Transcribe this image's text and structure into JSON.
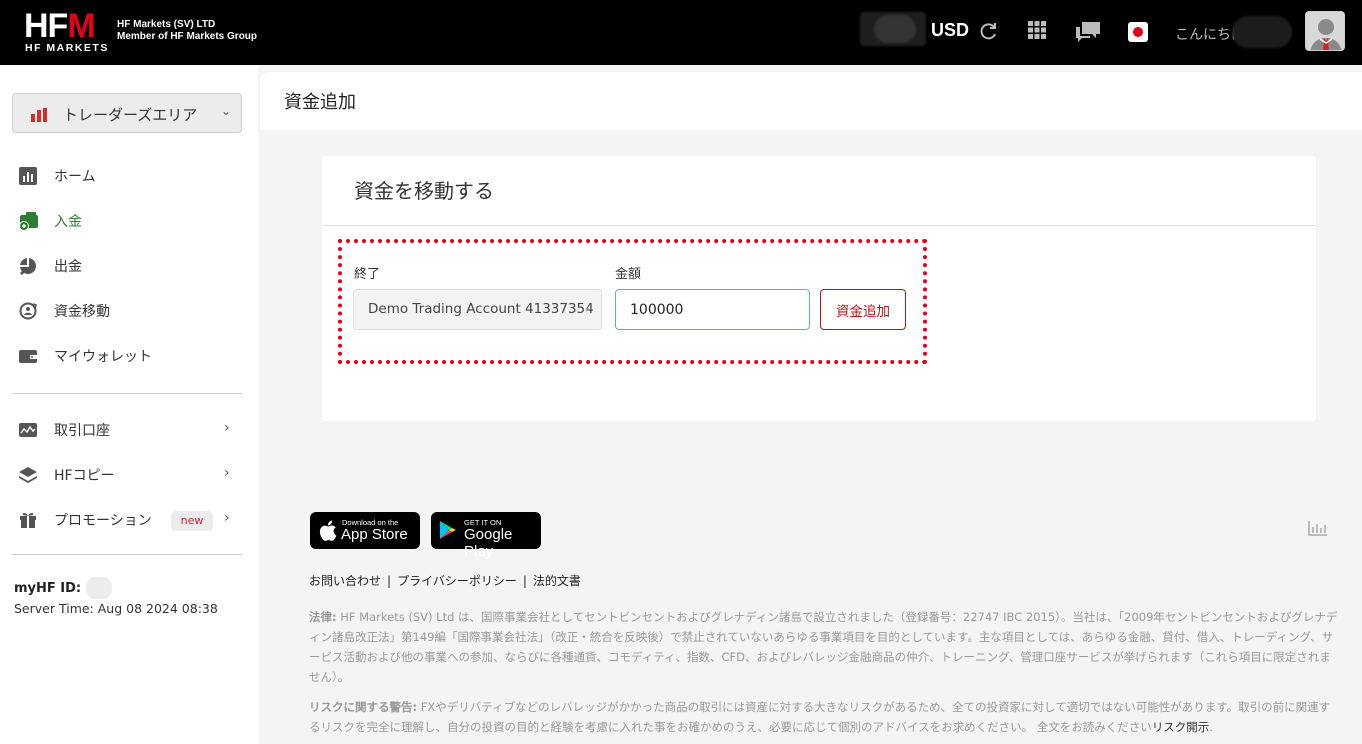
{
  "header": {
    "logo_text": "HFM",
    "logo_sub": "HF MARKETS",
    "company_line1": "HF Markets (SV) LTD",
    "company_line2": "Member of HF Markets Group",
    "currency": "USD",
    "greeting": "こんにちは"
  },
  "sidebar": {
    "area_select": "トレーダーズエリア",
    "items": [
      {
        "label": "ホーム",
        "icon": "bar-chart-icon"
      },
      {
        "label": "入金",
        "icon": "deposit-icon"
      },
      {
        "label": "出金",
        "icon": "withdraw-icon"
      },
      {
        "label": "資金移動",
        "icon": "transfer-icon"
      },
      {
        "label": "マイウォレット",
        "icon": "wallet-icon"
      },
      {
        "label": "取引口座",
        "icon": "trading-account-icon"
      },
      {
        "label": "HFコピー",
        "icon": "layers-icon"
      },
      {
        "label": "プロモーション",
        "icon": "gift-icon"
      }
    ],
    "new_badge": "new",
    "myhf_label": "myHF ID:",
    "server_time": "Server Time: Aug 08 2024 08:38"
  },
  "main": {
    "page_title": "資金追加",
    "card_title": "資金を移動する",
    "to_label": "終了",
    "amount_label": "金額",
    "account_value": "Demo Trading Account 41337354",
    "amount_value": "100000",
    "add_button": "資金追加"
  },
  "footer": {
    "app_store_small": "Download on the",
    "app_store_big": "App Store",
    "google_small": "GET IT ON",
    "google_big": "Google Play",
    "link_contact": "お問い合わせ",
    "link_privacy": "プライバシーポリシー",
    "link_legal": "法的文書",
    "legal_label": "法律:",
    "legal_text": " HF Markets (SV) Ltd は、国際事業会社としてセントビンセントおよびグレナディン諸島で設立されました（登録番号：22747 IBC 2015）。当社は、「2009年セントビンセントおよびグレナディン諸島改正法」第149編「国際事業会社法」（改正・統合を反映後）で禁止されていないあらゆる事業項目を目的としています。主な項目としては、あらゆる金融、貸付、借入、トレーディング、サービス活動および他の事業への参加、ならびに各種通貨、コモディティ、指数、CFD、およびレバレッジ金融商品の仲介、トレーニング、管理口座サービスが挙げられます（これら項目に限定されません）。",
    "risk_label": "リスクに関する警告:",
    "risk_text": " FXやデリバティブなどのレバレッジがかかった商品の取引には資産に対する大きなリスクがあるため、全ての投資家に対して適切ではない可能性があります。取引の前に関連するリスクを完全に理解し、自分の投資の目的と経験を考慮に入れた事をお確かめのうえ、必要に応じて個別のアドバイスをお求めください。 全文をお読みください",
    "risk_link": "リスク開示"
  },
  "colors": {
    "brand_red": "#e3001b",
    "active_green": "#2e7d32",
    "button_red": "#b0161d"
  }
}
